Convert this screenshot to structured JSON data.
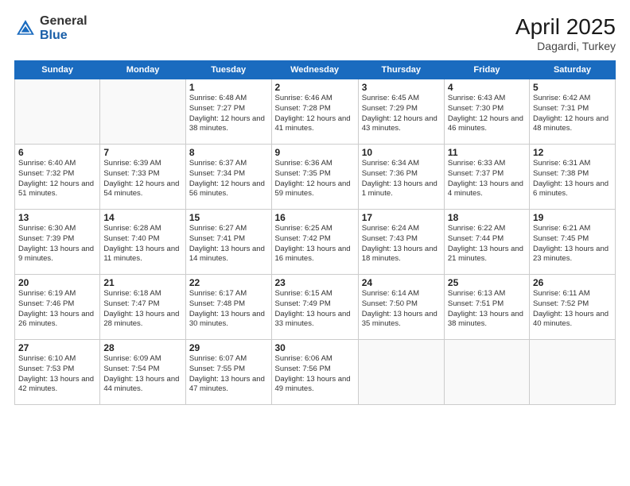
{
  "header": {
    "logo_general": "General",
    "logo_blue": "Blue",
    "month_title": "April 2025",
    "location": "Dagardi, Turkey"
  },
  "days_of_week": [
    "Sunday",
    "Monday",
    "Tuesday",
    "Wednesday",
    "Thursday",
    "Friday",
    "Saturday"
  ],
  "weeks": [
    [
      {
        "day": "",
        "info": ""
      },
      {
        "day": "",
        "info": ""
      },
      {
        "day": "1",
        "info": "Sunrise: 6:48 AM\nSunset: 7:27 PM\nDaylight: 12 hours and 38 minutes."
      },
      {
        "day": "2",
        "info": "Sunrise: 6:46 AM\nSunset: 7:28 PM\nDaylight: 12 hours and 41 minutes."
      },
      {
        "day": "3",
        "info": "Sunrise: 6:45 AM\nSunset: 7:29 PM\nDaylight: 12 hours and 43 minutes."
      },
      {
        "day": "4",
        "info": "Sunrise: 6:43 AM\nSunset: 7:30 PM\nDaylight: 12 hours and 46 minutes."
      },
      {
        "day": "5",
        "info": "Sunrise: 6:42 AM\nSunset: 7:31 PM\nDaylight: 12 hours and 48 minutes."
      }
    ],
    [
      {
        "day": "6",
        "info": "Sunrise: 6:40 AM\nSunset: 7:32 PM\nDaylight: 12 hours and 51 minutes."
      },
      {
        "day": "7",
        "info": "Sunrise: 6:39 AM\nSunset: 7:33 PM\nDaylight: 12 hours and 54 minutes."
      },
      {
        "day": "8",
        "info": "Sunrise: 6:37 AM\nSunset: 7:34 PM\nDaylight: 12 hours and 56 minutes."
      },
      {
        "day": "9",
        "info": "Sunrise: 6:36 AM\nSunset: 7:35 PM\nDaylight: 12 hours and 59 minutes."
      },
      {
        "day": "10",
        "info": "Sunrise: 6:34 AM\nSunset: 7:36 PM\nDaylight: 13 hours and 1 minute."
      },
      {
        "day": "11",
        "info": "Sunrise: 6:33 AM\nSunset: 7:37 PM\nDaylight: 13 hours and 4 minutes."
      },
      {
        "day": "12",
        "info": "Sunrise: 6:31 AM\nSunset: 7:38 PM\nDaylight: 13 hours and 6 minutes."
      }
    ],
    [
      {
        "day": "13",
        "info": "Sunrise: 6:30 AM\nSunset: 7:39 PM\nDaylight: 13 hours and 9 minutes."
      },
      {
        "day": "14",
        "info": "Sunrise: 6:28 AM\nSunset: 7:40 PM\nDaylight: 13 hours and 11 minutes."
      },
      {
        "day": "15",
        "info": "Sunrise: 6:27 AM\nSunset: 7:41 PM\nDaylight: 13 hours and 14 minutes."
      },
      {
        "day": "16",
        "info": "Sunrise: 6:25 AM\nSunset: 7:42 PM\nDaylight: 13 hours and 16 minutes."
      },
      {
        "day": "17",
        "info": "Sunrise: 6:24 AM\nSunset: 7:43 PM\nDaylight: 13 hours and 18 minutes."
      },
      {
        "day": "18",
        "info": "Sunrise: 6:22 AM\nSunset: 7:44 PM\nDaylight: 13 hours and 21 minutes."
      },
      {
        "day": "19",
        "info": "Sunrise: 6:21 AM\nSunset: 7:45 PM\nDaylight: 13 hours and 23 minutes."
      }
    ],
    [
      {
        "day": "20",
        "info": "Sunrise: 6:19 AM\nSunset: 7:46 PM\nDaylight: 13 hours and 26 minutes."
      },
      {
        "day": "21",
        "info": "Sunrise: 6:18 AM\nSunset: 7:47 PM\nDaylight: 13 hours and 28 minutes."
      },
      {
        "day": "22",
        "info": "Sunrise: 6:17 AM\nSunset: 7:48 PM\nDaylight: 13 hours and 30 minutes."
      },
      {
        "day": "23",
        "info": "Sunrise: 6:15 AM\nSunset: 7:49 PM\nDaylight: 13 hours and 33 minutes."
      },
      {
        "day": "24",
        "info": "Sunrise: 6:14 AM\nSunset: 7:50 PM\nDaylight: 13 hours and 35 minutes."
      },
      {
        "day": "25",
        "info": "Sunrise: 6:13 AM\nSunset: 7:51 PM\nDaylight: 13 hours and 38 minutes."
      },
      {
        "day": "26",
        "info": "Sunrise: 6:11 AM\nSunset: 7:52 PM\nDaylight: 13 hours and 40 minutes."
      }
    ],
    [
      {
        "day": "27",
        "info": "Sunrise: 6:10 AM\nSunset: 7:53 PM\nDaylight: 13 hours and 42 minutes."
      },
      {
        "day": "28",
        "info": "Sunrise: 6:09 AM\nSunset: 7:54 PM\nDaylight: 13 hours and 44 minutes."
      },
      {
        "day": "29",
        "info": "Sunrise: 6:07 AM\nSunset: 7:55 PM\nDaylight: 13 hours and 47 minutes."
      },
      {
        "day": "30",
        "info": "Sunrise: 6:06 AM\nSunset: 7:56 PM\nDaylight: 13 hours and 49 minutes."
      },
      {
        "day": "",
        "info": ""
      },
      {
        "day": "",
        "info": ""
      },
      {
        "day": "",
        "info": ""
      }
    ]
  ]
}
